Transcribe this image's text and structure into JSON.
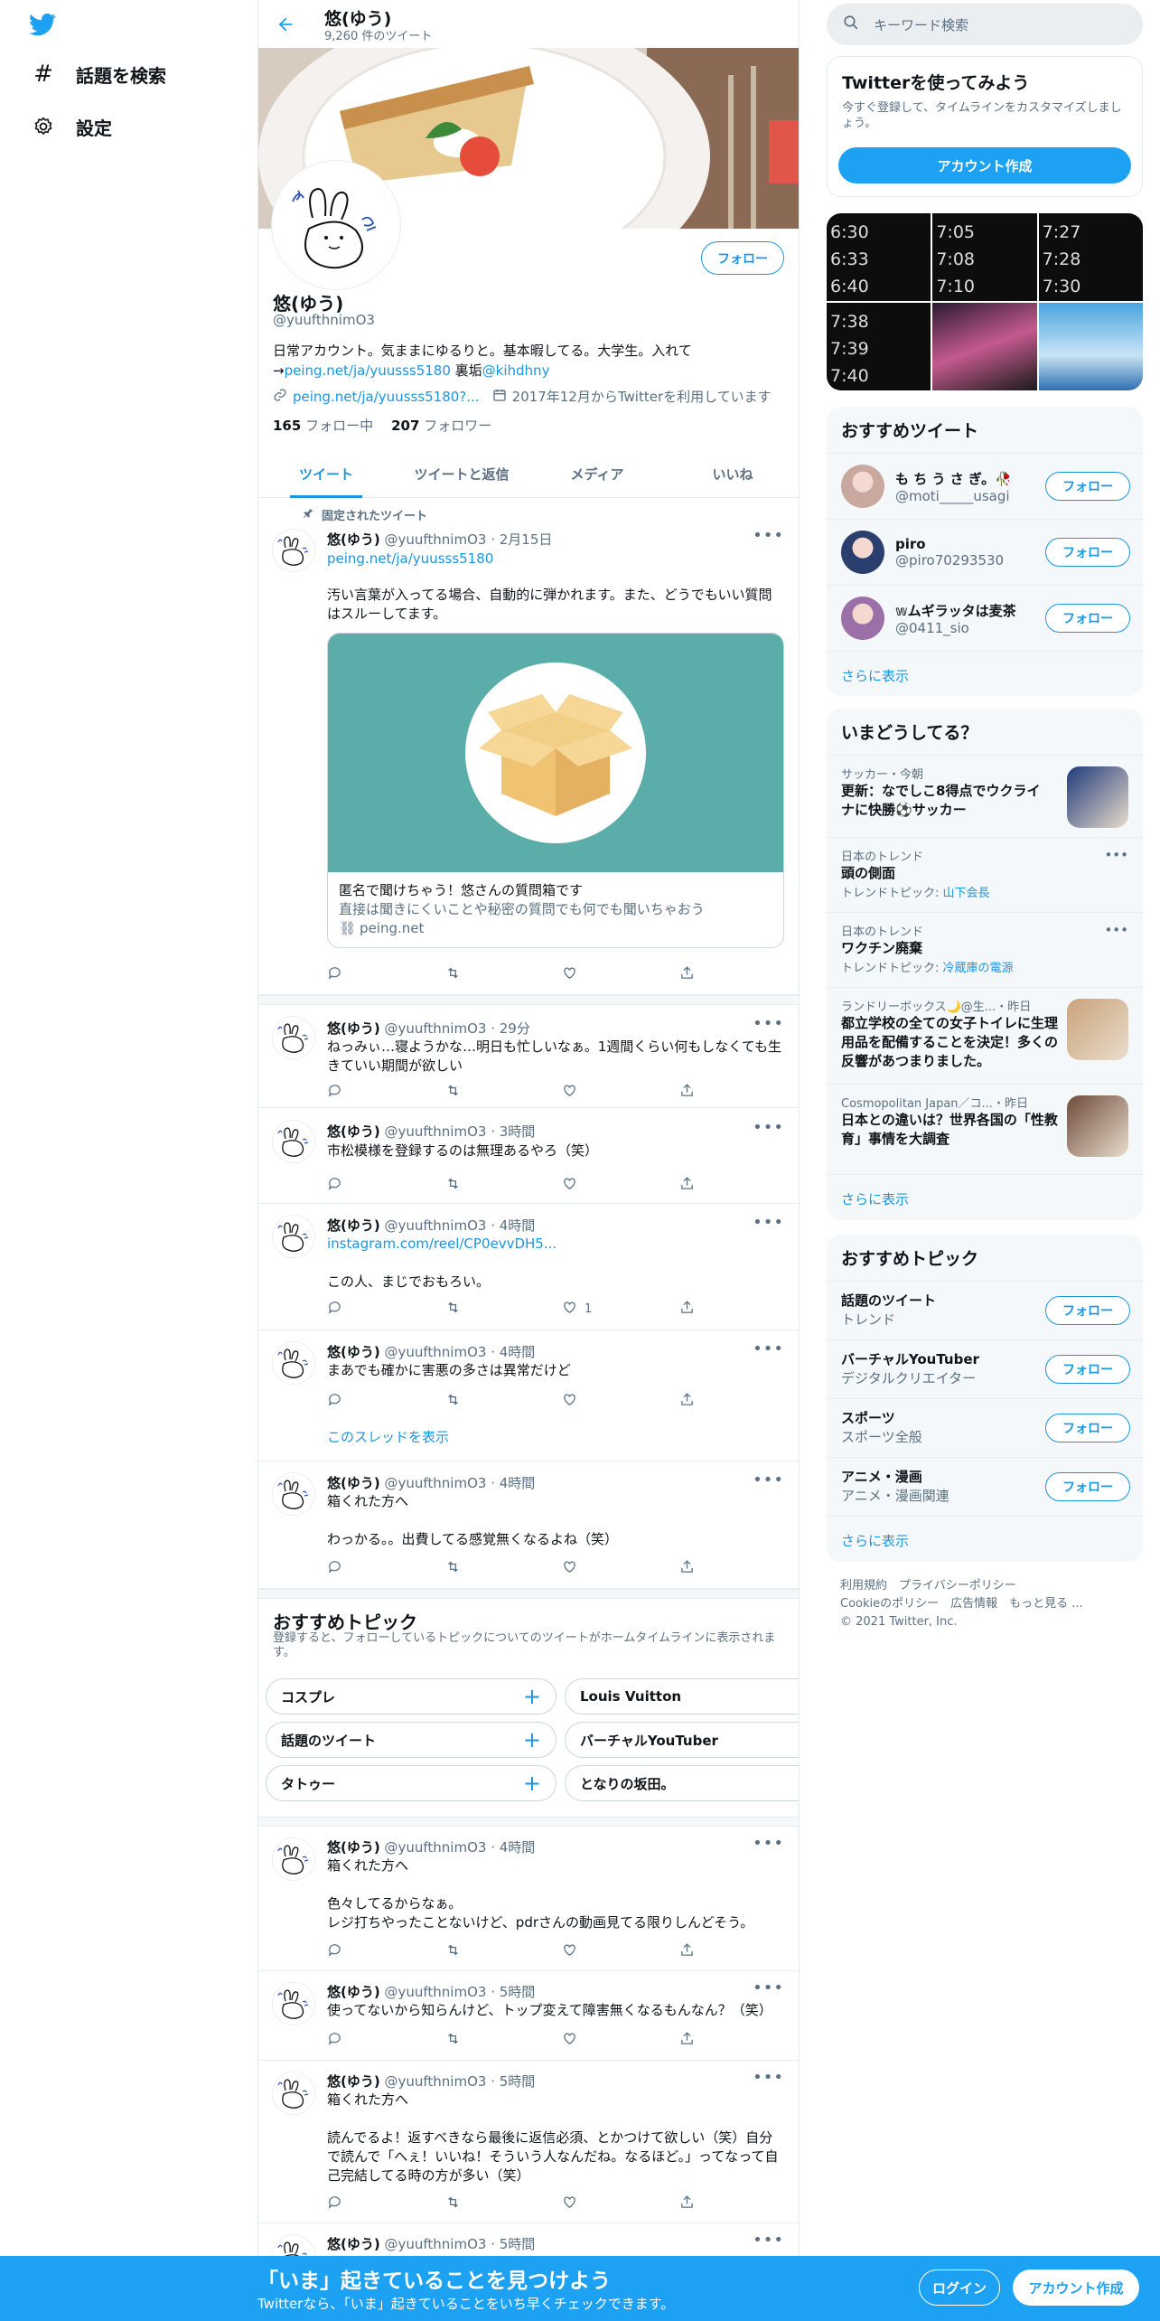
{
  "nav": {
    "explore_label": "話題を検索",
    "settings_label": "設定"
  },
  "header": {
    "name": "悠(ゆう)",
    "tweet_count": "9,260 件のツイート"
  },
  "profile": {
    "name": "悠(ゆう)",
    "handle": "@yuufthnimO3",
    "bio_line1": "日常アカウント。気ままにゆるりと。基本暇してる。大学生。入れて",
    "bio_arrow": "→",
    "bio_link": "peing.net/ja/yuusss5180",
    "bio_sub": " 裏垢",
    "bio_mention": "@kihdhny",
    "website": "peing.net/ja/yuusss5180?...",
    "joined": "2017年12月からTwitterを利用しています",
    "following_count": "165",
    "following_label": "フォロー中",
    "followers_count": "207",
    "followers_label": "フォロワー",
    "follow_label": "フォロー"
  },
  "tabs": [
    "ツイート",
    "ツイートと返信",
    "メディア",
    "いいね"
  ],
  "pinned_label": "固定されたツイート",
  "tweets": [
    {
      "name": "悠(ゆう)",
      "meta": "@yuufthnimO3 · 2月15日",
      "link": "peing.net/ja/yuusss5180",
      "text": "汚い言葉が入ってる場合、自動的に弾かれます。また、どうでもいい質問はスルーしてます。",
      "card_title": "匿名で聞けちゃう！悠さんの質問箱です",
      "card_desc": "直接は聞きにくいことや秘密の質問でも何でも聞いちゃおう",
      "card_domain": "peing.net"
    },
    {
      "name": "悠(ゆう)",
      "meta": "@yuufthnimO3 · 29分",
      "text": "ねっみぃ…寝ようかな…明日も忙しいなぁ。1週間くらい何もしなくても生きていい期間が欲しい"
    },
    {
      "name": "悠(ゆう)",
      "meta": "@yuufthnimO3 · 3時間",
      "text": "市松模様を登録するのは無理あるやろ（笑）"
    },
    {
      "name": "悠(ゆう)",
      "meta": "@yuufthnimO3 · 4時間",
      "link": "instagram.com/reel/CP0evvDH5...",
      "text": "この人、まじでおもろい。",
      "likes": "1"
    },
    {
      "name": "悠(ゆう)",
      "meta": "@yuufthnimO3 · 4時間",
      "text": "まあでも確かに害悪の多さは異常だけど",
      "thread": "このスレッドを表示"
    },
    {
      "name": "悠(ゆう)",
      "meta": "@yuufthnimO3 · 4時間",
      "text": "箱くれた方へ\n\nわっかる。。出費してる感覚無くなるよね（笑）"
    },
    {
      "name": "悠(ゆう)",
      "meta": "@yuufthnimO3 · 4時間",
      "text": "箱くれた方へ\n\n色々してるからなぁ。\nレジ打ちやったことないけど、pdrさんの動画見てる限りしんどそう。"
    },
    {
      "name": "悠(ゆう)",
      "meta": "@yuufthnimO3 · 5時間",
      "text": "使ってないから知らんけど、トップ変えて障害無くなるもんなん？（笑）"
    },
    {
      "name": "悠(ゆう)",
      "meta": "@yuufthnimO3 · 5時間",
      "text": "箱くれた方へ\n\n読んでるよ！返すべきなら最後に返信必須、とかつけて欲しい（笑）自分で読んで「へぇ！いいね！そういう人なんだね。なるほど。」ってなって自己完結してる時の方が多い（笑）"
    },
    {
      "name": "悠(ゆう)",
      "meta": "@yuufthnimO3 · 5時間"
    }
  ],
  "main_topics": {
    "title": "おすすめトピック",
    "desc": "登録すると、フォローしているトピックについてのツイートがホームタイムラインに表示されます。",
    "chips": [
      "コスプレ",
      "Louis Vuitton",
      "話題のツイート",
      "バーチャルYouTuber",
      "タトゥー",
      "となりの坂田。"
    ],
    "plus": "+"
  },
  "search": {
    "placeholder": "キーワード検索"
  },
  "signup_box": {
    "title": "Twitterを使ってみよう",
    "desc": "今すぐ登録して、タイムラインをカスタマイズしましょう。",
    "button": "アカウント作成"
  },
  "media_grid": {
    "cells": [
      [
        "6:30",
        "6:33",
        "6:40"
      ],
      [
        "7:05",
        "7:08",
        "7:10"
      ],
      [
        "7:27",
        "7:28",
        "7:30"
      ],
      [
        "7:38",
        "7:39",
        "7:40"
      ]
    ]
  },
  "who_to_follow": {
    "title": "おすすめツイート",
    "users": [
      {
        "name": "も ち う さ ぎ。🥀",
        "handle": "@moti_____usagi",
        "color": "#c9a8a0"
      },
      {
        "name": "piro",
        "handle": "@piro70293530",
        "color": "#2a3f6e"
      },
      {
        "name": "𝕨ムギラッタは麦茶",
        "handle": "@0411_sio",
        "color": "#9b6fa8"
      }
    ],
    "follow_label": "フォロー",
    "more": "さらに表示"
  },
  "trends": {
    "title": "いまどうしてる？",
    "items": [
      {
        "meta": "サッカー・今朝",
        "title": "更新：なでしこ8得点でウクライナに快勝⚽サッカー",
        "thumb": "#1f3a7a"
      },
      {
        "meta": "日本のトレンド",
        "title": "頭の側面",
        "sub_prefix": "トレンドトピック: ",
        "sub_link": "山下会長"
      },
      {
        "meta": "日本のトレンド",
        "title": "ワクチン廃棄",
        "sub_prefix": "トレンドトピック: ",
        "sub_link": "冷蔵庫の電源"
      },
      {
        "meta": "ランドリーボックス🌙@生...・昨日",
        "title": "都立学校の全ての女子トイレに生理用品を配備することを決定！多くの反響があつまりました。",
        "thumb": "#c9a37a"
      },
      {
        "meta": "Cosmopolitan Japan／コ...・昨日",
        "title": "日本との違いは？世界各国の「性教育」事情を大調査",
        "thumb": "#6e4b3a"
      }
    ],
    "more": "さらに表示"
  },
  "topics_box": {
    "title": "おすすめトピック",
    "items": [
      {
        "name": "話題のツイート",
        "sub": "トレンド"
      },
      {
        "name": "バーチャルYouTuber",
        "sub": "デジタルクリエイター"
      },
      {
        "name": "スポーツ",
        "sub": "スポーツ全般"
      },
      {
        "name": "アニメ・漫画",
        "sub": "アニメ・漫画関連"
      }
    ],
    "follow_label": "フォロー",
    "more": "さらに表示"
  },
  "footer": {
    "line1": "利用規約　プライバシーポリシー",
    "line2": "Cookieのポリシー　広告情報　もっと見る ...",
    "line3": "© 2021 Twitter, Inc."
  },
  "bottom_bar": {
    "headline": "「いま」起きていることを見つけよう",
    "sub": "Twitterなら、「いま」起きていることをいち早くチェックできます。",
    "login": "ログイン",
    "signup": "アカウント作成"
  },
  "colors": {
    "accent": "#1da1f2",
    "link": "#1b95e0",
    "card_bg": "#5aada8"
  }
}
